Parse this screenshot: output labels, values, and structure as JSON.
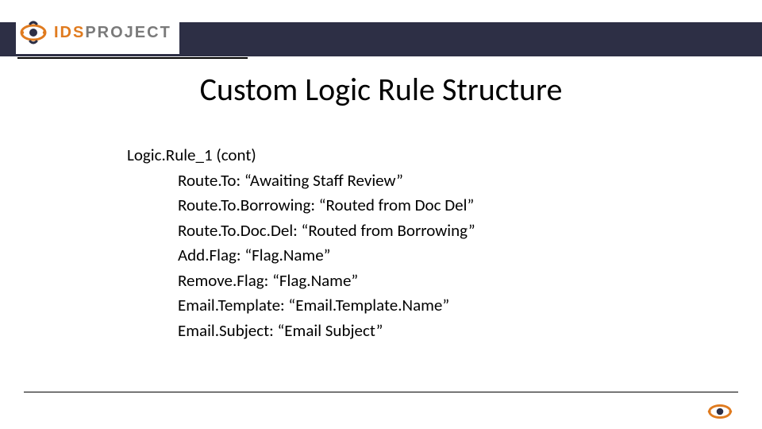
{
  "brand": {
    "name_part1": "IDS",
    "name_part2": "PROJECT",
    "accent_color": "#e07b1f",
    "muted_color": "#7a7a7a",
    "band_color": "#2d2f45"
  },
  "slide": {
    "title": "Custom Logic Rule Structure"
  },
  "rule": {
    "section_label": "Logic.Rule_1 (cont)",
    "items": [
      {
        "key": "Route.To:",
        "value": "“Awaiting Staff Review”"
      },
      {
        "key": "Route.To.Borrowing:",
        "value": "“Routed from Doc Del”"
      },
      {
        "key": "Route.To.Doc.Del:",
        "value": "“Routed from Borrowing”"
      },
      {
        "key": "Add.Flag:",
        "value": "“Flag.Name”"
      },
      {
        "key": "Remove.Flag:",
        "value": "“Flag.Name”"
      },
      {
        "key": "Email.Template:",
        "value": "“Email.Template.Name”"
      },
      {
        "key": "Email.Subject:",
        "value": "“Email Subject”"
      }
    ]
  }
}
